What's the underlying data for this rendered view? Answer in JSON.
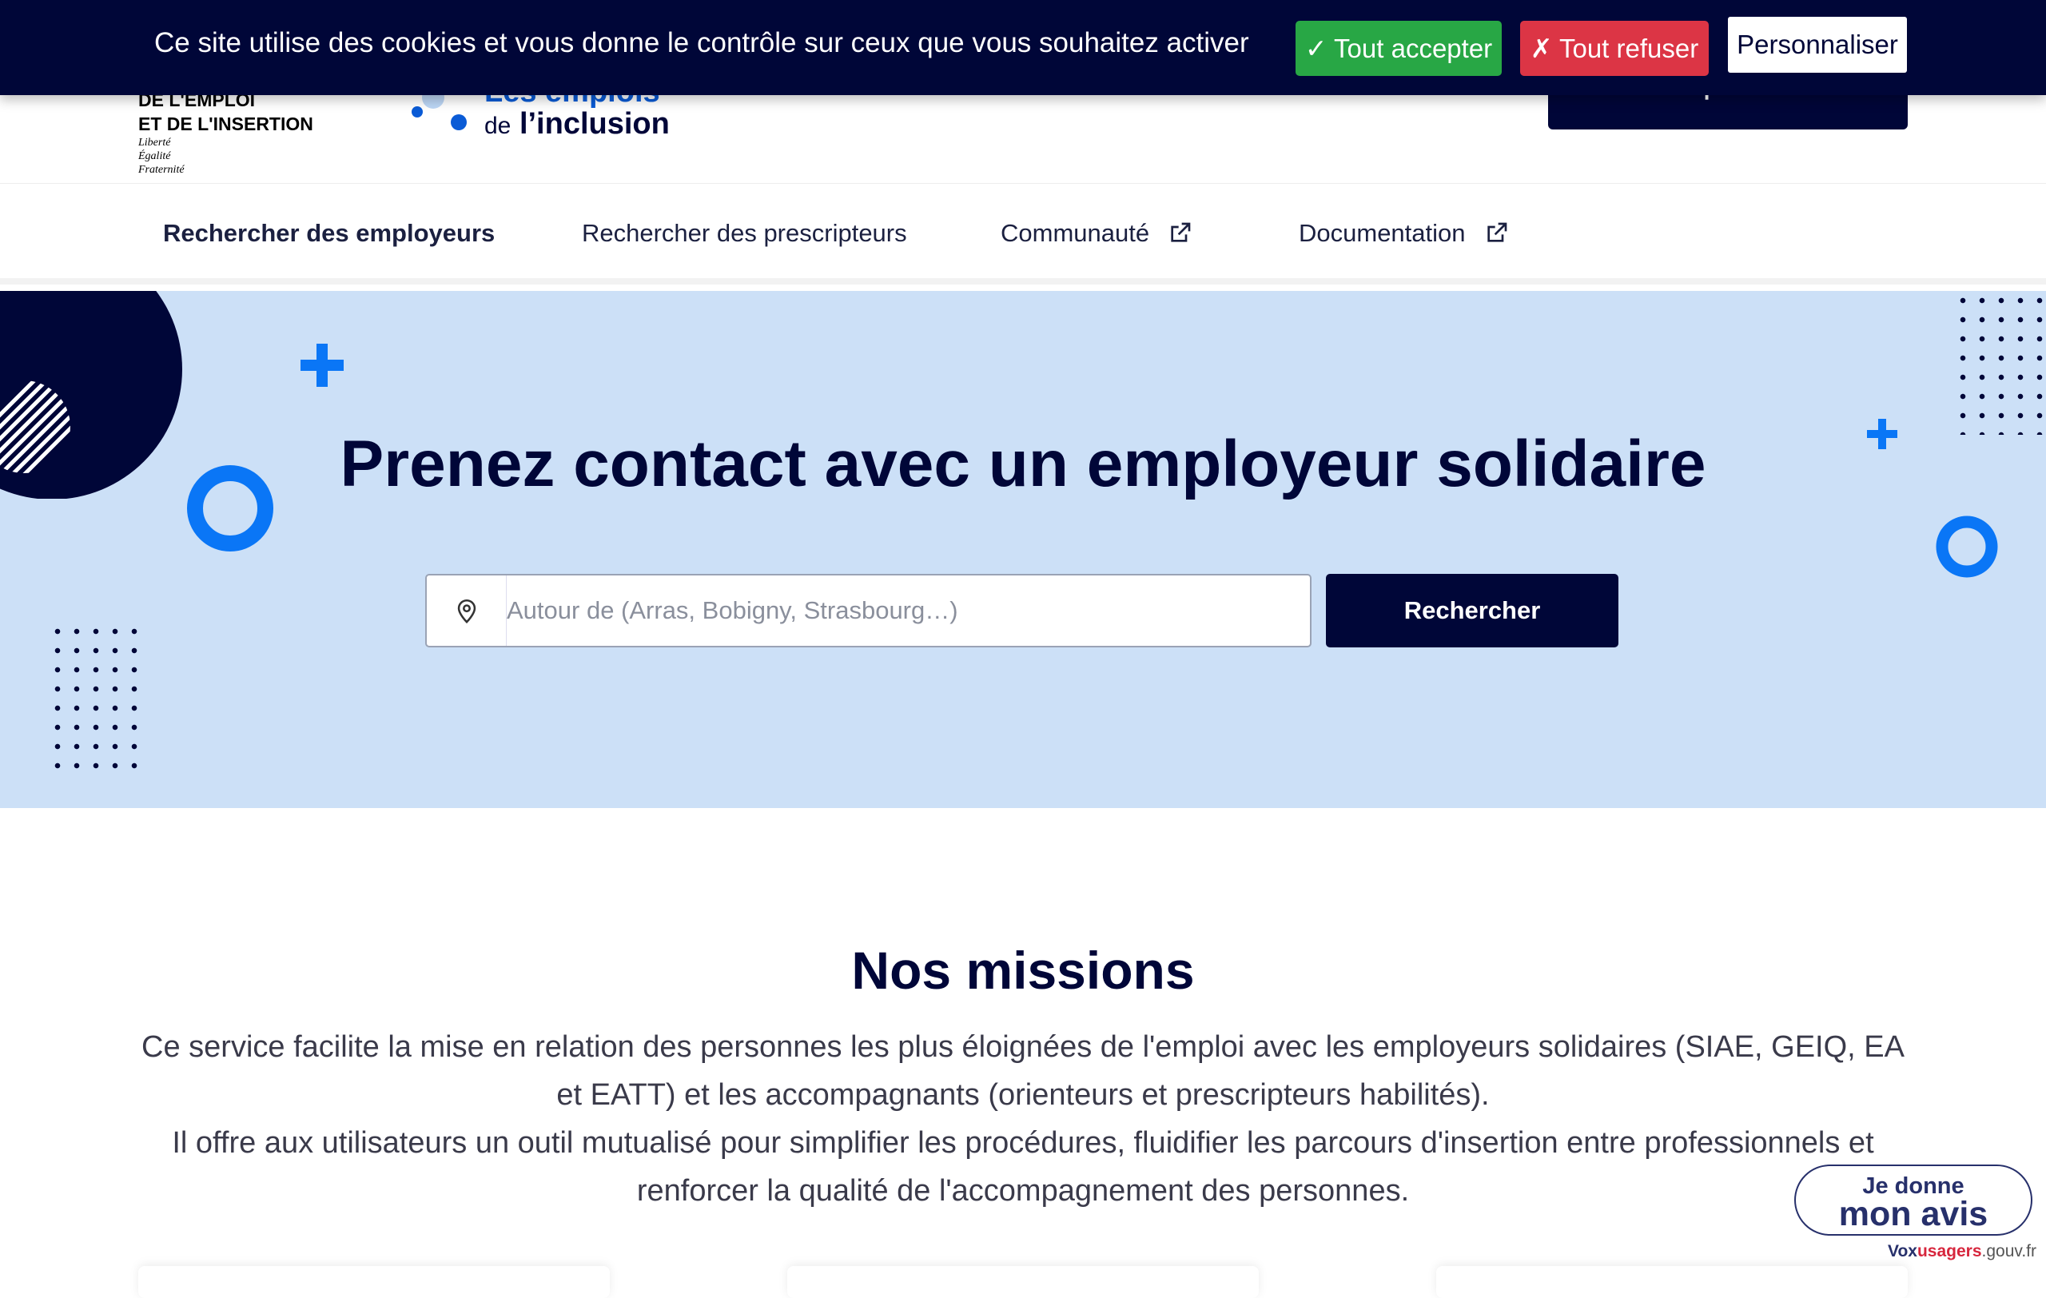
{
  "cookie_banner": {
    "message": "Ce site utilise des cookies et vous donne le contrôle sur ceux que vous souhaitez activer",
    "accept_label": "✓ Tout accepter",
    "refuse_label": "✗ Tout refuser",
    "customize_label": "Personnaliser"
  },
  "header": {
    "ministry_lines": [
      "DE L'EMPLOI",
      "ET DE L'INSERTION"
    ],
    "motto": [
      "Liberté",
      "Égalité",
      "Fraternité"
    ],
    "logo_line1": "Les emplois",
    "logo_line2_prefix": "de",
    "logo_line2": "l’inclusion",
    "login_label": "S'inscrire | Se connecter"
  },
  "nav": {
    "items": [
      {
        "label": "Rechercher des employeurs"
      },
      {
        "label": "Rechercher des prescripteurs"
      },
      {
        "label": "Communauté"
      },
      {
        "label": "Documentation"
      }
    ]
  },
  "hero": {
    "title": "Prenez contact avec un employeur solidaire",
    "search_placeholder": "Autour de (Arras, Bobigny, Strasbourg…)",
    "search_button": "Rechercher"
  },
  "missions": {
    "title": "Nos missions",
    "paragraph1": "Ce service facilite la mise en relation des personnes les plus éloignées de l'emploi avec les employeurs solidaires (SIAE, GEIQ, EA et EATT) et les accompagnants (orienteurs et prescripteurs habilités).",
    "paragraph2": "Il offre aux utilisateurs un outil mutualisé pour simplifier les procédures, fluidifier les parcours d'insertion entre professionnels et renforcer la qualité de l'accompagnement des personnes."
  },
  "feedback": {
    "line1": "Je donne",
    "line2": "mon avis",
    "link_a": "Vox",
    "link_b": "usagers",
    "link_c": ".gouv.fr"
  },
  "colors": {
    "navy": "#000638",
    "accept": "#28a745",
    "refuse": "#dc3545",
    "hero_bg": "#cce0f7",
    "accent_blue": "#0a76f6"
  }
}
